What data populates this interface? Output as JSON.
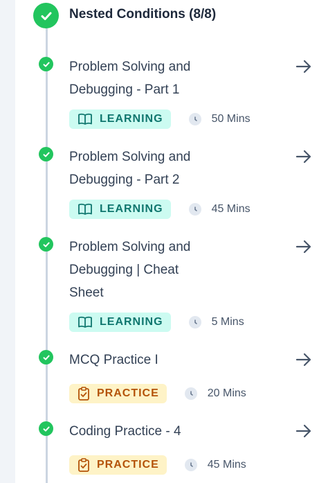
{
  "section": {
    "title": "Nested Conditions (8/8)",
    "check_icon": "check-circle-icon",
    "accent_color": "#22c55e"
  },
  "items": [
    {
      "title": "Problem Solving and Debugging - Part 1",
      "type": "LEARNING",
      "icon": "book-icon",
      "duration": "50 Mins"
    },
    {
      "title": "Problem Solving and Debugging - Part 2",
      "type": "LEARNING",
      "icon": "book-icon",
      "duration": "45 Mins"
    },
    {
      "title": "Problem Solving and Debugging | Cheat Sheet",
      "type": "LEARNING",
      "icon": "book-icon",
      "duration": "5 Mins"
    },
    {
      "title": "MCQ Practice I",
      "type": "PRACTICE",
      "icon": "clipboard-check-icon",
      "duration": "20 Mins"
    },
    {
      "title": "Coding Practice - 4",
      "type": "PRACTICE",
      "icon": "clipboard-check-icon",
      "duration": "45 Mins"
    }
  ],
  "colors": {
    "learning_bg": "#ccfbf1",
    "learning_fg": "#0f766e",
    "practice_bg": "#fef3c7",
    "practice_fg": "#b45309"
  }
}
